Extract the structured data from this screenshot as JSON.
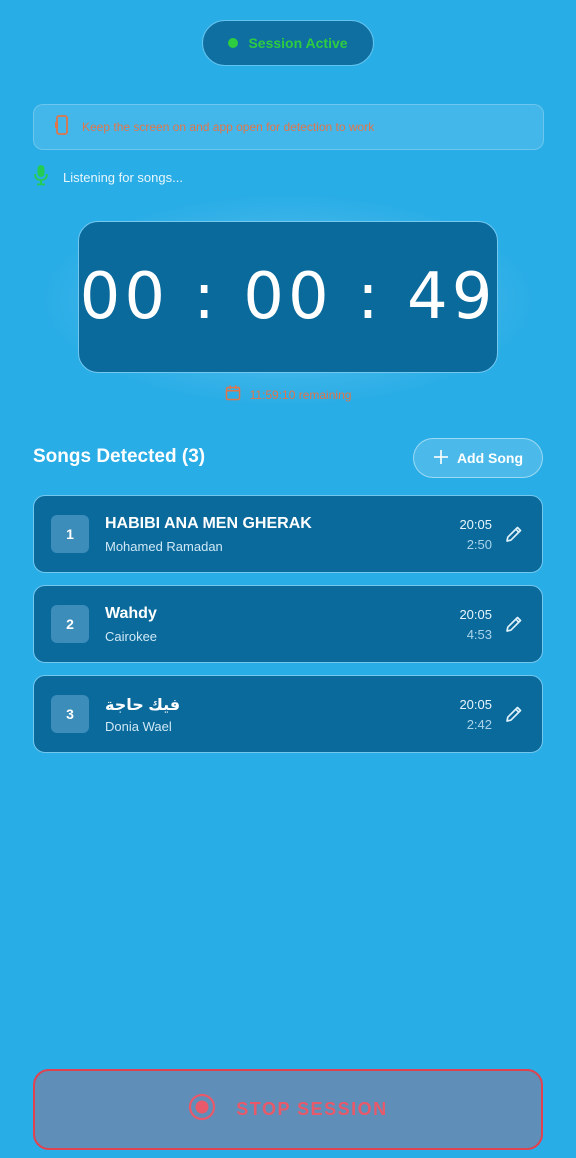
{
  "session": {
    "status_label": "Session Active",
    "status_color": "#2ecc40"
  },
  "warning": {
    "icon": "phone-icon",
    "text": "Keep the screen on and app open for detection to work"
  },
  "listening": {
    "icon": "microphone-icon",
    "text": "Listening for songs..."
  },
  "timer": {
    "display": "00:00:49",
    "remaining_icon": "calendar-icon",
    "remaining_text": "11:59:10 remaining"
  },
  "songs_section": {
    "title": "Songs Detected (3)",
    "add_label": "Add Song"
  },
  "songs": [
    {
      "index": "1",
      "title": "HABIBI ANA MEN GHERAK",
      "artist": "Mohamed Ramadan",
      "time": "20:05",
      "duration": "2:50"
    },
    {
      "index": "2",
      "title": "Wahdy",
      "artist": "Cairokee",
      "time": "20:05",
      "duration": "4:53"
    },
    {
      "index": "3",
      "title": "فيك حاجة",
      "artist": "Donia Wael",
      "time": "20:05",
      "duration": "2:42"
    }
  ],
  "stop": {
    "label": "STOP SESSION",
    "icon": "record-stop-icon",
    "accent_color": "#e0424f"
  }
}
